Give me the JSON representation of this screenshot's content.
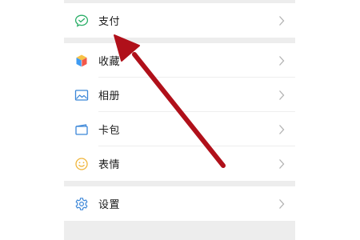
{
  "menu": {
    "pay": {
      "label": "支付",
      "icon": "wechat-pay-icon"
    },
    "group2": [
      {
        "key": "favorites",
        "label": "收藏",
        "icon": "favorites-cube-icon"
      },
      {
        "key": "album",
        "label": "相册",
        "icon": "album-picture-icon"
      },
      {
        "key": "cards",
        "label": "卡包",
        "icon": "card-wallet-icon"
      },
      {
        "key": "emoji",
        "label": "表情",
        "icon": "emoji-smile-icon"
      }
    ],
    "settings": {
      "label": "设置",
      "icon": "settings-gear-icon"
    }
  },
  "colors": {
    "background": "#ededed",
    "panel_white": "#ffffff",
    "arrow_red": "#b0101a",
    "chevron": "#b2b2b2",
    "pay_green": "#2aae67"
  }
}
